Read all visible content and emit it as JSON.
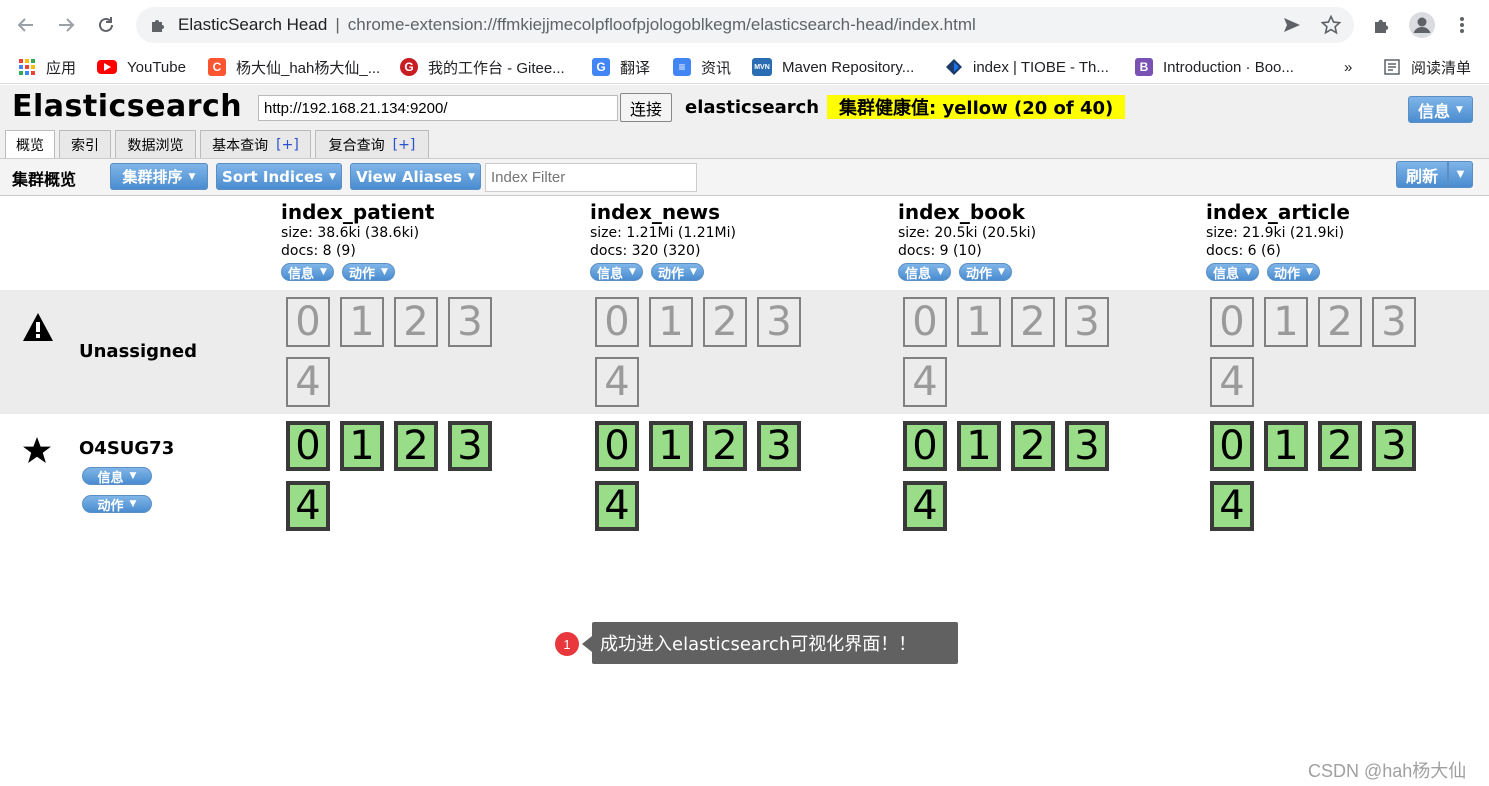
{
  "browser": {
    "site_name": "ElasticSearch Head",
    "separator": "|",
    "url": "chrome-extension://ffmkiejjmecolpfloofpjologoblkegm/elasticsearch-head/index.html",
    "bookmarks": [
      {
        "label": "应用",
        "icon": "apps-grid-icon"
      },
      {
        "label": "YouTube",
        "icon": "youtube-icon",
        "color": "#ff0000"
      },
      {
        "label": "杨大仙_hah杨大仙_...",
        "icon": "csdn-icon",
        "color": "#fc5531"
      },
      {
        "label": "我的工作台 - Gitee...",
        "icon": "gitee-icon",
        "color": "#c71d23"
      },
      {
        "label": "翻译",
        "icon": "translate-icon",
        "color": "#4285f4"
      },
      {
        "label": "资讯",
        "icon": "news-icon",
        "color": "#4285f4"
      },
      {
        "label": "Maven Repository...",
        "icon": "maven-icon",
        "color": "#2a6db3"
      },
      {
        "label": "index | TIOBE - Th...",
        "icon": "tiobe-icon",
        "color": "#1a73e8"
      },
      {
        "label": "Introduction · Boo...",
        "icon": "bootstrap-icon",
        "color": "#7952b3"
      },
      {
        "label": "»",
        "icon": ""
      },
      {
        "label": "阅读清单",
        "icon": "reading-list-icon"
      }
    ]
  },
  "es": {
    "title": "Elasticsearch",
    "connect_url": "http://192.168.21.134:9200/",
    "connect_label": "连接",
    "cluster_name": "elasticsearch",
    "health": "集群健康值: yellow (20 of 40)",
    "info_label": "信息",
    "tabs": [
      {
        "label": "概览",
        "plus": ""
      },
      {
        "label": "索引",
        "plus": ""
      },
      {
        "label": "数据浏览",
        "plus": ""
      },
      {
        "label": "基本查询",
        "plus": "[+]"
      },
      {
        "label": "复合查询",
        "plus": "[+]"
      }
    ],
    "toolbar": {
      "label": "集群概览",
      "sort_cluster": "集群排序",
      "sort_indices": "Sort Indices",
      "view_aliases": "View Aliases",
      "index_filter_placeholder": "Index Filter",
      "refresh": "刷新"
    },
    "indices": [
      {
        "name": "index_patient",
        "size": "size: 38.6ki (38.6ki)",
        "docs": "docs: 8 (9)",
        "info": "信息",
        "action": "动作"
      },
      {
        "name": "index_news",
        "size": "size: 1.21Mi (1.21Mi)",
        "docs": "docs: 320 (320)",
        "info": "信息",
        "action": "动作"
      },
      {
        "name": "index_book",
        "size": "size: 20.5ki (20.5ki)",
        "docs": "docs: 9 (10)",
        "info": "信息",
        "action": "动作"
      },
      {
        "name": "index_article",
        "size": "size: 21.9ki (21.9ki)",
        "docs": "docs: 6 (6)",
        "info": "信息",
        "action": "动作"
      }
    ],
    "shard_numbers": [
      "0",
      "1",
      "2",
      "3",
      "4"
    ],
    "unassigned_label": "Unassigned",
    "node": {
      "name": "O4SUG73",
      "info": "信息",
      "action": "动作"
    }
  },
  "annotation": {
    "badge": "1",
    "text": "成功进入elasticsearch可视化界面！！"
  },
  "watermark": "CSDN @hah杨大仙"
}
